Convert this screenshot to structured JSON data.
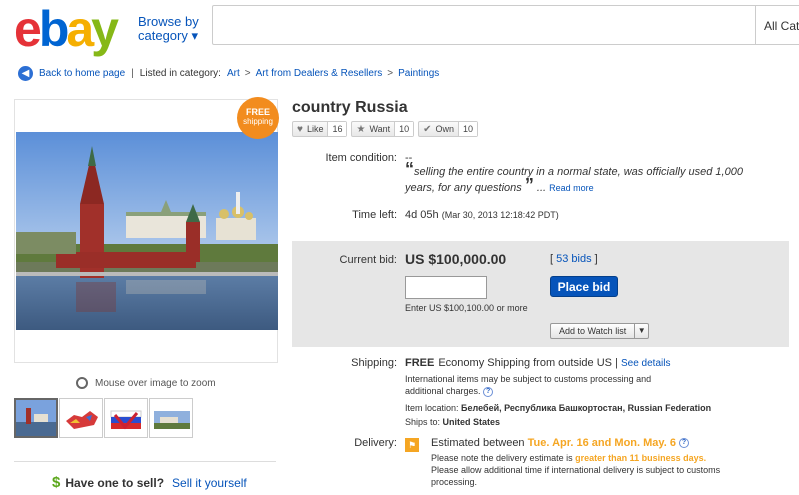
{
  "header": {
    "logo": {
      "e": "e",
      "b": "b",
      "a": "a",
      "y": "y"
    },
    "browse_line1": "Browse by",
    "browse_line2": "category ▾",
    "search_placeholder": "",
    "category_select": "All Cate"
  },
  "breadcrumb": {
    "back_label": "Back to home page",
    "listed_label": "Listed in category:",
    "items": [
      "Art",
      "Art from Dealers & Resellers",
      "Paintings"
    ]
  },
  "gallery": {
    "badge_line1": "FREE",
    "badge_line2": "shipping",
    "zoom_text": "Mouse over image to zoom",
    "thumbnail_count": 4
  },
  "sell": {
    "dollar": "$",
    "question": "Have one to sell?",
    "link": "Sell it yourself"
  },
  "item": {
    "title": "country Russia",
    "social": [
      {
        "label": "Like",
        "icon": "♥",
        "count": "16"
      },
      {
        "label": "Want",
        "icon": "★",
        "count": "10"
      },
      {
        "label": "Own",
        "icon": "✔",
        "count": "10"
      }
    ],
    "condition_label": "Item condition:",
    "condition_value": "--",
    "description": "selling the entire country in a normal state, was officially used 1,000 years, for any questions",
    "read_more": "Read more",
    "time_left_label": "Time left:",
    "time_left": "4d 05h",
    "end_time": "(Mar 30, 2013  12:18:42 PDT)"
  },
  "bid": {
    "current_bid_label": "Current bid:",
    "price": "US $100,000.00",
    "bids_count": "53 bids",
    "place_bid": "Place bid",
    "enter_hint": "Enter US $100,100.00 or more",
    "watch_label": "Add to Watch list"
  },
  "shipping": {
    "label": "Shipping:",
    "free": "FREE",
    "method": "Economy Shipping from outside US |",
    "see_details": "See details",
    "customs_line1": "International items may be subject to customs processing and",
    "customs_line2": "additional charges.",
    "location_label": "Item location:",
    "location": "Белебей, Республика Башкортостан, Russian Federation",
    "ships_to_label": "Ships to:",
    "ships_to": "United States"
  },
  "delivery": {
    "label": "Delivery:",
    "estimated": "Estimated between",
    "range": "Tue. Apr. 16 and Mon. May. 6",
    "note_prefix": "Please note the delivery estimate is",
    "note_highlight": "greater than 11 business days.",
    "note2_line1": "Please allow additional time if international delivery is subject to customs",
    "note2_line2": "processing."
  },
  "colors": {
    "accent": "#0654ba",
    "orange": "#f5a623",
    "bid_bg": "#e6e6e6"
  }
}
